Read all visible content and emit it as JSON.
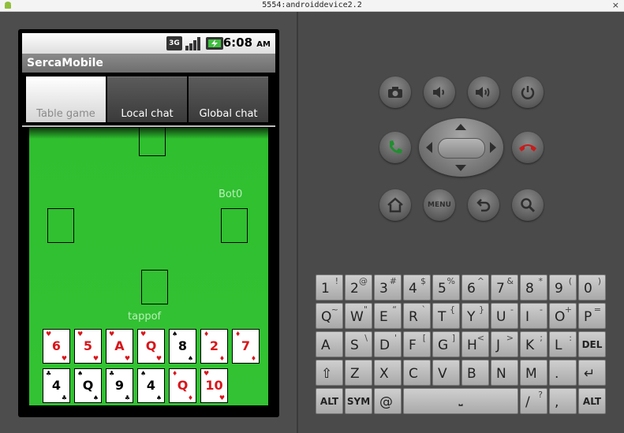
{
  "window": {
    "title": "5554:androiddevice2.2",
    "close_glyph": "×"
  },
  "status": {
    "time": "6:08",
    "ampm": "AM",
    "network_label": "3G"
  },
  "app": {
    "title": "SercaMobile"
  },
  "tabs": [
    {
      "label": "Table game",
      "active": true
    },
    {
      "label": "Local chat",
      "active": false
    },
    {
      "label": "Global chat",
      "active": false
    }
  ],
  "table": {
    "players": {
      "right": "Bot0",
      "bottom": "tappof"
    },
    "hand_row1": [
      {
        "rank": "6",
        "suit": "hearts"
      },
      {
        "rank": "5",
        "suit": "hearts"
      },
      {
        "rank": "A",
        "suit": "hearts"
      },
      {
        "rank": "Q",
        "suit": "hearts"
      },
      {
        "rank": "8",
        "suit": "spades"
      },
      {
        "rank": "2",
        "suit": "diamonds"
      },
      {
        "rank": "7",
        "suit": "diamonds"
      }
    ],
    "hand_row2": [
      {
        "rank": "4",
        "suit": "clubs"
      },
      {
        "rank": "Q",
        "suit": "spades"
      },
      {
        "rank": "9",
        "suit": "clubs"
      },
      {
        "rank": "4",
        "suit": "spades"
      },
      {
        "rank": "Q",
        "suit": "diamonds"
      },
      {
        "rank": "10",
        "suit": "hearts"
      }
    ]
  },
  "hw_buttons": [
    "camera-icon",
    "volume-down-icon",
    "volume-up-icon",
    "power-icon",
    "call-icon",
    "end-call-icon",
    "home-icon",
    "menu-button",
    "back-icon",
    "search-icon"
  ],
  "menu_label": "MENU",
  "keyboard": {
    "row1": [
      [
        "1",
        "!"
      ],
      [
        "2",
        "@"
      ],
      [
        "3",
        "#"
      ],
      [
        "4",
        "$"
      ],
      [
        "5",
        "%"
      ],
      [
        "6",
        "^"
      ],
      [
        "7",
        "&"
      ],
      [
        "8",
        "*"
      ],
      [
        "9",
        "("
      ],
      [
        "0",
        ")"
      ]
    ],
    "row2": [
      [
        "Q",
        "~"
      ],
      [
        "W",
        "\""
      ],
      [
        "E",
        "“"
      ],
      [
        "R",
        "`"
      ],
      [
        "T",
        "{"
      ],
      [
        "Y",
        "}"
      ],
      [
        "U",
        "-"
      ],
      [
        "I",
        "-"
      ],
      [
        "O",
        "+"
      ],
      [
        "P",
        "="
      ]
    ],
    "row3": [
      [
        "A",
        ""
      ],
      [
        "S",
        "\\"
      ],
      [
        "D",
        "'"
      ],
      [
        "F",
        "["
      ],
      [
        "G",
        "]"
      ],
      [
        "H",
        "<"
      ],
      [
        "J",
        ">"
      ],
      [
        "K",
        ";"
      ],
      [
        "L",
        ":"
      ],
      [
        "DEL",
        ""
      ]
    ],
    "row4": [
      [
        "⇧",
        ""
      ],
      [
        "Z",
        ""
      ],
      [
        "X",
        ""
      ],
      [
        "C",
        ""
      ],
      [
        "V",
        ""
      ],
      [
        "B",
        ""
      ],
      [
        "N",
        ""
      ],
      [
        "M",
        ""
      ],
      [
        ".",
        ""
      ],
      [
        "↵",
        ""
      ]
    ],
    "row5": [
      [
        "ALT",
        ""
      ],
      [
        "SYM",
        ""
      ],
      [
        "@",
        ""
      ],
      [
        "⎵",
        ""
      ],
      [
        "/",
        "?"
      ],
      [
        ",",
        ""
      ],
      [
        "ALT",
        ""
      ]
    ]
  },
  "colors": {
    "felt": "#33c233",
    "red_suit": "#d8161b"
  }
}
